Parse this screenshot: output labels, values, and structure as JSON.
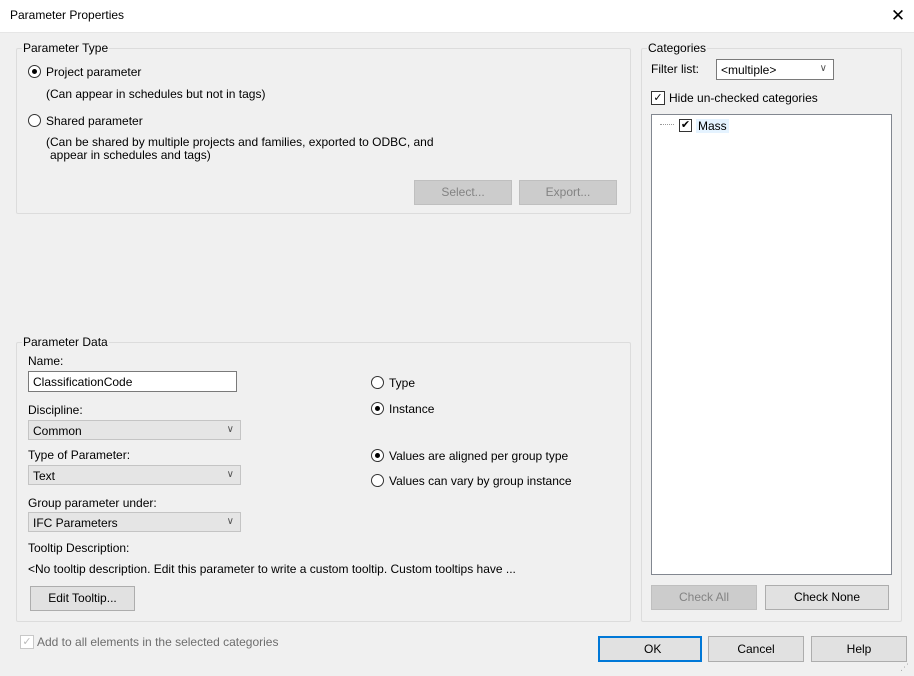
{
  "window": {
    "title": "Parameter Properties",
    "close_glyph": "✕"
  },
  "param_type": {
    "group_label": "Parameter Type",
    "project_label": "Project parameter",
    "project_desc": "(Can appear in schedules but not in tags)",
    "shared_label": "Shared parameter",
    "shared_desc_line1": "(Can be shared by multiple projects and families, exported to ODBC, and",
    "shared_desc_line2": "appear in schedules and tags)",
    "select_label": "Select...",
    "export_label": "Export..."
  },
  "param_data": {
    "group_label": "Parameter Data",
    "name_label": "Name:",
    "name_value": "ClassificationCode",
    "discipline_label": "Discipline:",
    "discipline_value": "Common",
    "type_of_param_label": "Type of Parameter:",
    "type_of_param_value": "Text",
    "group_under_label": "Group parameter under:",
    "group_under_value": "IFC Parameters",
    "type_radio": "Type",
    "instance_radio": "Instance",
    "aligned_radio": "Values are aligned per group type",
    "vary_radio": "Values can vary by group instance",
    "tooltip_label": "Tooltip Description:",
    "tooltip_text": "<No tooltip description. Edit this parameter to write a custom tooltip. Custom tooltips have ...",
    "edit_tooltip_label": "Edit Tooltip..."
  },
  "categories": {
    "group_label": "Categories",
    "filter_label": "Filter list:",
    "filter_value": "<multiple>",
    "hide_label": "Hide un-checked categories",
    "items": [
      {
        "label": "Mass",
        "checked": true
      }
    ],
    "check_all_label": "Check All",
    "check_none_label": "Check None"
  },
  "footer": {
    "add_all_label": "Add to all elements in the selected categories",
    "ok_label": "OK",
    "cancel_label": "Cancel",
    "help_label": "Help"
  },
  "state": {
    "project_selected": true,
    "instance_selected": true,
    "aligned_selected": true,
    "hide_unchecked": true,
    "add_all_checked": true,
    "add_all_disabled": true
  },
  "colors": {
    "accent": "#0078d7",
    "dialog_bg": "#f0f0f0",
    "disabled_button": "#cccccc"
  }
}
